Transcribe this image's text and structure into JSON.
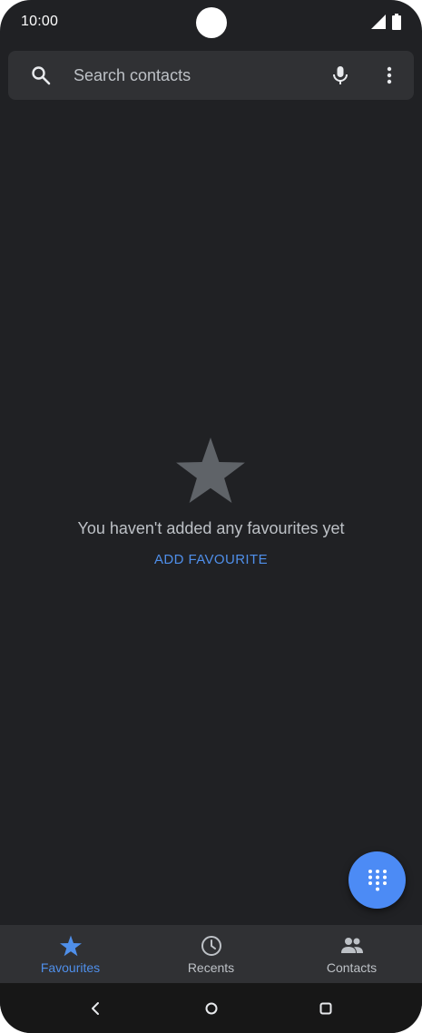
{
  "status_bar": {
    "time": "10:00"
  },
  "search": {
    "placeholder": "Search contacts"
  },
  "empty_state": {
    "message": "You haven't added any favourites yet",
    "action_label": "ADD FAVOURITE"
  },
  "bottom_nav": {
    "items": [
      {
        "label": "Favourites",
        "icon": "star-icon",
        "active": true
      },
      {
        "label": "Recents",
        "icon": "clock-icon",
        "active": false
      },
      {
        "label": "Contacts",
        "icon": "people-icon",
        "active": false
      }
    ]
  },
  "fab": {
    "icon": "dialpad-icon"
  },
  "system_nav": {
    "icons": [
      "back-icon",
      "home-icon",
      "recents-icon"
    ]
  },
  "colors": {
    "background": "#202124",
    "surface": "#303134",
    "accent": "#4f8fea",
    "fab": "#4c8bf5",
    "text_secondary": "#bdc1c6"
  }
}
